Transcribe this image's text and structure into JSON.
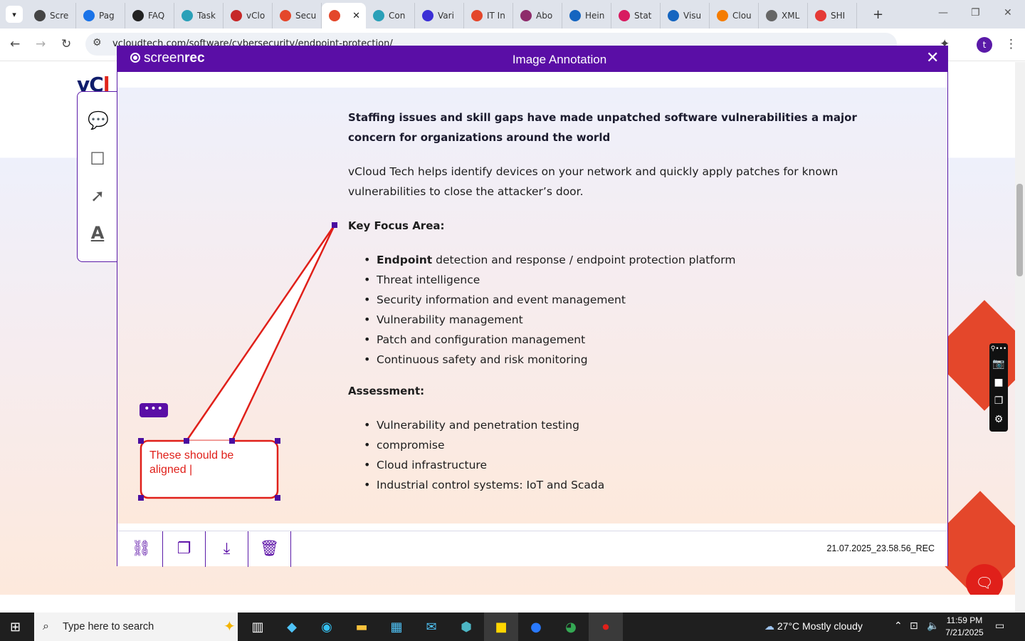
{
  "browser": {
    "tabs": [
      {
        "label": "Scre",
        "color": "#444444"
      },
      {
        "label": "Pag",
        "color": "#1a73e8"
      },
      {
        "label": "FAQ",
        "color": "#222222"
      },
      {
        "label": "Task",
        "color": "#2aa0b8"
      },
      {
        "label": "vClo",
        "color": "#c62828"
      },
      {
        "label": "Secu",
        "color": "#e4472b"
      },
      {
        "label": "",
        "color": "#e4472b",
        "active": true
      },
      {
        "label": "Con",
        "color": "#2aa0b8"
      },
      {
        "label": "Vari",
        "color": "#3b2fd6"
      },
      {
        "label": "IT In",
        "color": "#e4472b"
      },
      {
        "label": "Abo",
        "color": "#8e2c6b"
      },
      {
        "label": "Hein",
        "color": "#1565c0"
      },
      {
        "label": "Stat",
        "color": "#d81b60"
      },
      {
        "label": "Visu",
        "color": "#1565c0"
      },
      {
        "label": "Clou",
        "color": "#f57c00"
      },
      {
        "label": "XML",
        "color": "#666666"
      },
      {
        "label": "SHI",
        "color": "#e53935"
      }
    ],
    "close_tab_glyph": "✕",
    "new_tab_glyph": "+",
    "url": "vcloudtech.com/software/cybersecurity/endpoint-protection/",
    "profile_initial": "t"
  },
  "page": {
    "logo_main": "vC",
    "logo_accent": "l"
  },
  "modal": {
    "brand_light": "screen",
    "brand_bold": "rec",
    "title": "Image Annotation",
    "close_glyph": "✕",
    "lead": "Staffing issues and skill gaps have made unpatched software vulnerabilities a major concern for organizations around the world",
    "intro": "vCloud Tech helps identify devices on your network and quickly apply patches for known vulnerabilities to close the attacker’s door.",
    "focus_heading": "Key Focus Area:",
    "focus_first_bold": "Endpoint",
    "focus_first_rest": " detection and response / endpoint protection platform",
    "focus_items": [
      "Threat intelligence",
      "Security information and event management",
      "Vulnerability management",
      "Patch and configuration management",
      "Continuous safety and risk monitoring"
    ],
    "assessment_heading": "Assessment:",
    "assessment_items": [
      "Vulnerability and penetration testing",
      "compromise",
      "Cloud infrastructure",
      "Industrial control systems: IoT and Scada"
    ],
    "annotation_text": "These should be aligned |",
    "more_glyph": "•••",
    "filename": "21.07.2025_23.58.56_REC",
    "footer_buttons": [
      {
        "name": "copy-link-button",
        "icon": "link-icon",
        "glyph": "⛓"
      },
      {
        "name": "copy-button",
        "icon": "copy-icon",
        "glyph": "❐"
      },
      {
        "name": "download-button",
        "icon": "download-icon",
        "glyph": "⤓"
      },
      {
        "name": "delete-button",
        "icon": "trash-icon",
        "glyph": "🗑"
      }
    ]
  },
  "tools": [
    {
      "name": "comment-tool",
      "icon": "speech-bubble-icon",
      "glyph": "💬"
    },
    {
      "name": "rectangle-tool",
      "icon": "square-icon",
      "glyph": "☐"
    },
    {
      "name": "arrow-tool",
      "icon": "arrow-icon",
      "glyph": "➚"
    },
    {
      "name": "text-tool",
      "icon": "text-icon",
      "glyph": "A"
    }
  ],
  "taskbar": {
    "search_placeholder": "Type here to search",
    "weather": "27°C  Mostly cloudy",
    "time": "11:59 PM",
    "date": "7/21/2025"
  },
  "colors": {
    "accent": "#5a0ea6",
    "annotation": "#e0201a"
  }
}
